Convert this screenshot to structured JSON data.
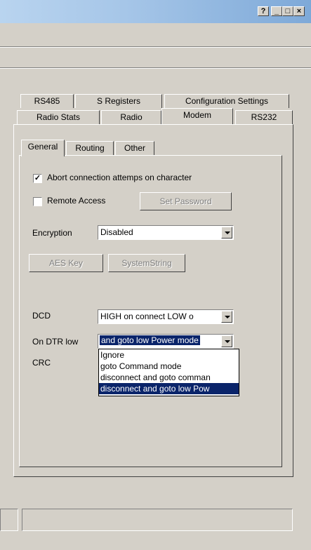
{
  "title_bar": {
    "help_label": "?",
    "minimize_label": "_",
    "maximize_label": "□",
    "close_label": "×"
  },
  "tabs": {
    "row_back": [
      {
        "label": "RS485"
      },
      {
        "label": "S Registers"
      },
      {
        "label": "Configuration Settings"
      }
    ],
    "row_front": [
      {
        "label": "Radio Stats"
      },
      {
        "label": "Radio"
      },
      {
        "label": "Modem",
        "selected": true
      },
      {
        "label": "RS232"
      }
    ]
  },
  "subtabs": [
    {
      "label": "General",
      "selected": true
    },
    {
      "label": "Routing"
    },
    {
      "label": "Other"
    }
  ],
  "general": {
    "abort_checkbox": {
      "label": "Abort connection attemps on character",
      "checked": true,
      "mark": "✓"
    },
    "remote_checkbox": {
      "label": "Remote Access",
      "checked": false
    },
    "set_password_label": "Set Password",
    "encryption_label": "Encryption",
    "encryption_value": "Disabled",
    "aes_key_label": "AES Key",
    "system_string_label": "SystemString",
    "dcd_label": "DCD",
    "dcd_value": "HIGH on connect LOW o",
    "dtr_label": "On DTR low",
    "dtr_value": "and goto low Power mode",
    "crc_label": "CRC",
    "dtr_options": [
      "Ignore",
      "goto Command mode",
      "disconnect and goto comman",
      "disconnect and goto low Pow"
    ],
    "dtr_selected_index": 3
  },
  "colors": {
    "face": "#d4d0c8",
    "selection": "#0a246a",
    "title_gradient_start": "#b9d4ef",
    "title_gradient_end": "#7ea9d8"
  }
}
